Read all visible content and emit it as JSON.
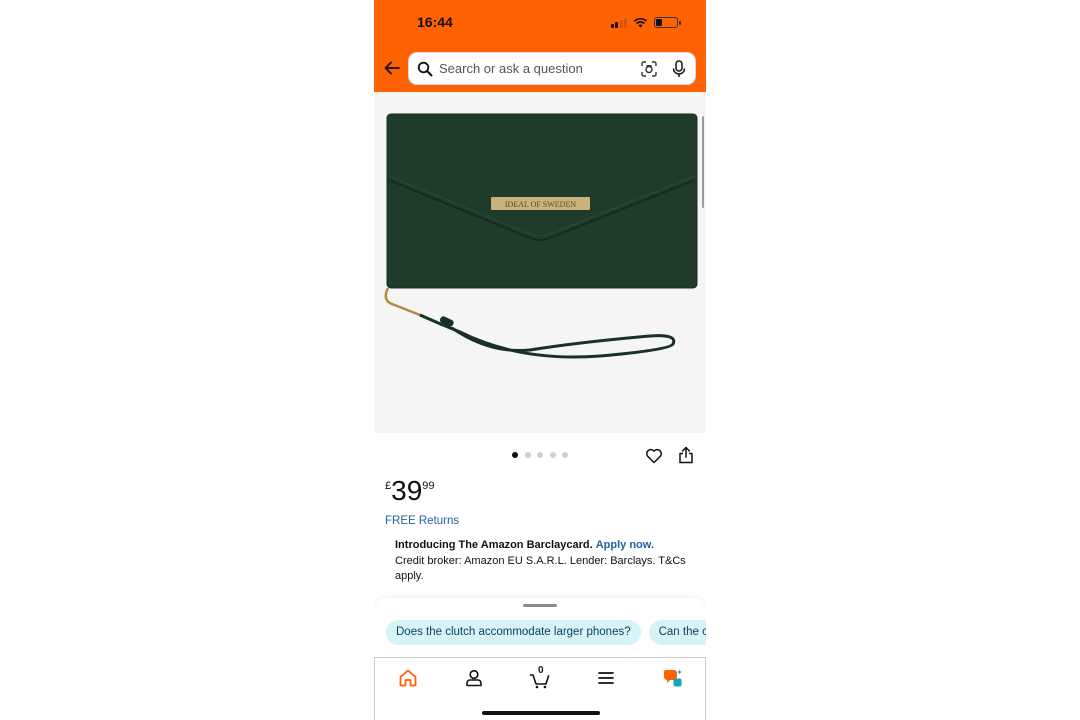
{
  "status_bar": {
    "time": "16:44"
  },
  "search": {
    "placeholder": "Search or ask a question"
  },
  "product": {
    "brand_plate": "IDEAL OF SWEDEN",
    "image_count": 5,
    "active_image_index": 0
  },
  "price": {
    "currency": "£",
    "whole": "39",
    "fraction": "99"
  },
  "free_returns": "FREE Returns",
  "promo": {
    "headline": "Introducing The Amazon Barclaycard.",
    "apply_link": "Apply now.",
    "body": "Credit broker: Amazon EU S.A.R.L. Lender: Barclays. T&Cs apply."
  },
  "suggestions": [
    "Does the clutch accommodate larger phones?",
    "Can the c"
  ],
  "nav": {
    "cart_count": "0"
  },
  "colors": {
    "header": "#ff6200",
    "link": "#2162a1",
    "chip_bg": "#d6f3f7",
    "nav_active": "#ff6200",
    "wallet": "#1f3b2a"
  },
  "icons": [
    "back-arrow-icon",
    "search-icon",
    "camera-lens-icon",
    "mic-icon",
    "heart-icon",
    "share-icon",
    "home-icon",
    "account-icon",
    "cart-icon",
    "menu-icon",
    "rufus-assistant-icon"
  ]
}
